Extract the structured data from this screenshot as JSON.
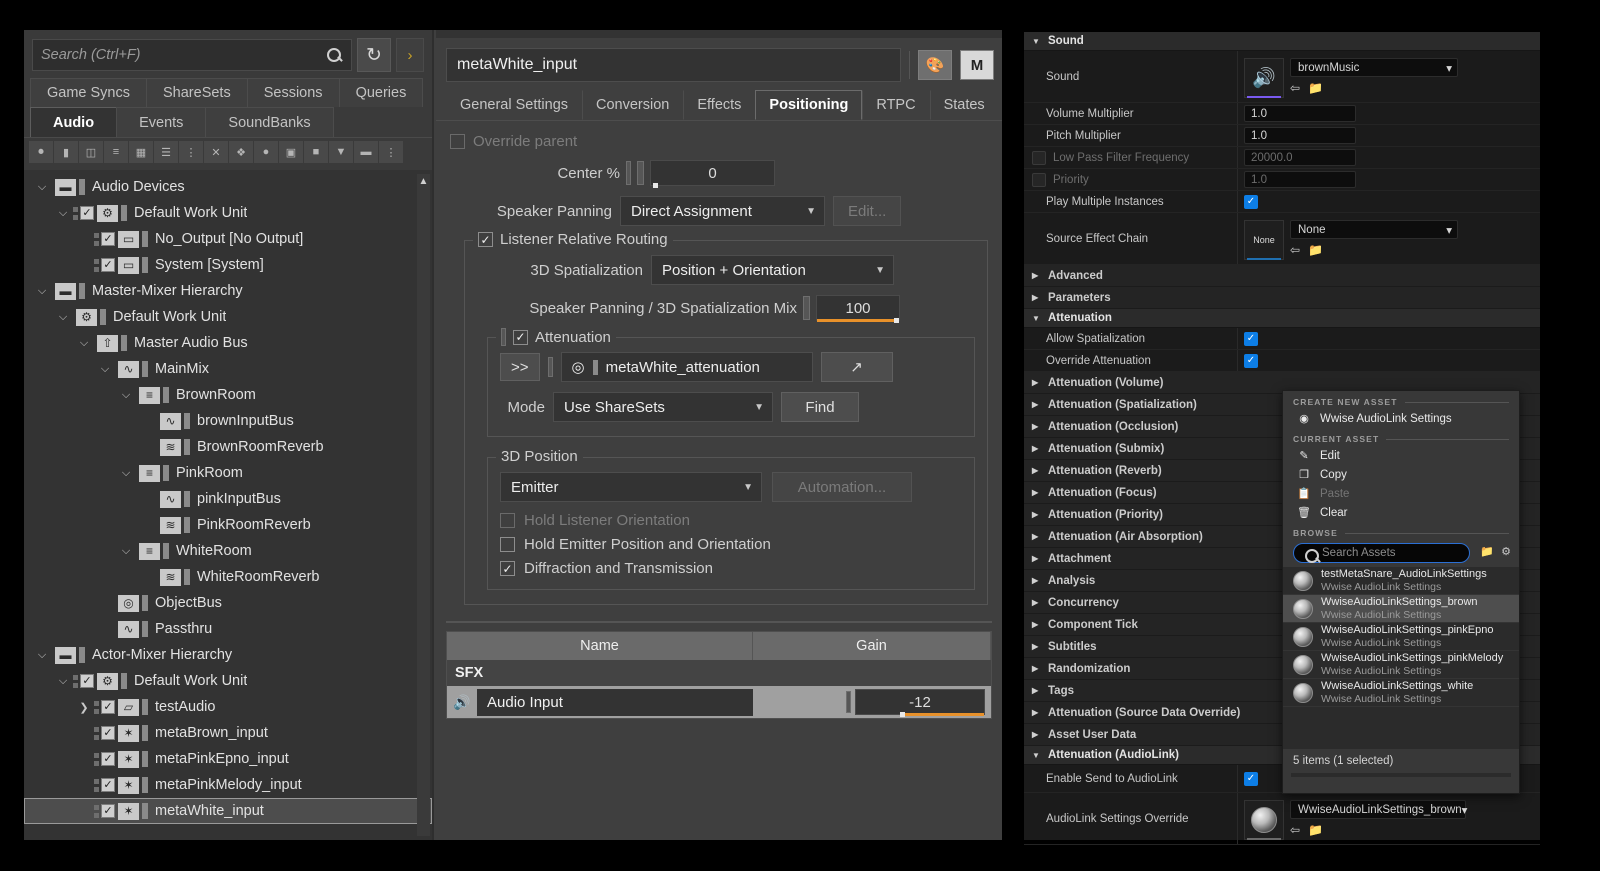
{
  "wwise": {
    "search": {
      "placeholder": "Search (Ctrl+F)",
      "value": ""
    },
    "refresh_label": "↻",
    "next_label": "›",
    "tabs_row1": [
      "Game Syncs",
      "ShareSets",
      "Sessions",
      "Queries"
    ],
    "tabs_row2": [
      "Audio",
      "Events",
      "SoundBanks"
    ],
    "active_tab_row2": "Audio",
    "tree": [
      {
        "label": "Audio Devices",
        "indent": 0,
        "twisty": "down",
        "check": false,
        "icon": "folder-icon"
      },
      {
        "label": "Default Work Unit",
        "indent": 1,
        "twisty": "down",
        "check": true,
        "icon": "work-unit-icon"
      },
      {
        "label": "No_Output [No Output]",
        "indent": 2,
        "twisty": "none",
        "check": true,
        "icon": "audio-device-icon"
      },
      {
        "label": "System [System]",
        "indent": 2,
        "twisty": "none",
        "check": true,
        "icon": "audio-device-icon"
      },
      {
        "label": "Master-Mixer Hierarchy",
        "indent": 0,
        "twisty": "down",
        "check": false,
        "icon": "folder-icon"
      },
      {
        "label": "Default Work Unit",
        "indent": 1,
        "twisty": "down",
        "check": false,
        "icon": "work-unit-icon"
      },
      {
        "label": "Master Audio Bus",
        "indent": 2,
        "twisty": "down",
        "check": false,
        "icon": "master-bus-icon"
      },
      {
        "label": "MainMix",
        "indent": 3,
        "twisty": "down",
        "check": false,
        "icon": "bus-icon"
      },
      {
        "label": "BrownRoom",
        "indent": 4,
        "twisty": "down",
        "check": false,
        "icon": "aux-bus-icon"
      },
      {
        "label": "brownInputBus",
        "indent": 5,
        "twisty": "none",
        "check": false,
        "icon": "bus-icon"
      },
      {
        "label": "BrownRoomReverb",
        "indent": 5,
        "twisty": "none",
        "check": false,
        "icon": "aux-reverb-icon"
      },
      {
        "label": "PinkRoom",
        "indent": 4,
        "twisty": "down",
        "check": false,
        "icon": "aux-bus-icon"
      },
      {
        "label": "pinkInputBus",
        "indent": 5,
        "twisty": "none",
        "check": false,
        "icon": "bus-icon"
      },
      {
        "label": "PinkRoomReverb",
        "indent": 5,
        "twisty": "none",
        "check": false,
        "icon": "aux-reverb-icon"
      },
      {
        "label": "WhiteRoom",
        "indent": 4,
        "twisty": "down",
        "check": false,
        "icon": "aux-bus-icon"
      },
      {
        "label": "WhiteRoomReverb",
        "indent": 5,
        "twisty": "none",
        "check": false,
        "icon": "aux-reverb-icon"
      },
      {
        "label": "ObjectBus",
        "indent": 3,
        "twisty": "none",
        "check": false,
        "icon": "object-bus-icon"
      },
      {
        "label": "Passthru",
        "indent": 3,
        "twisty": "none",
        "check": false,
        "icon": "bus-icon"
      },
      {
        "label": "Actor-Mixer Hierarchy",
        "indent": 0,
        "twisty": "down",
        "check": false,
        "icon": "folder-icon"
      },
      {
        "label": "Default Work Unit",
        "indent": 1,
        "twisty": "down",
        "check": true,
        "icon": "work-unit-icon"
      },
      {
        "label": "testAudio",
        "indent": 2,
        "twisty": "right",
        "check": true,
        "icon": "folder-open-icon"
      },
      {
        "label": "metaBrown_input",
        "indent": 2,
        "twisty": "none",
        "check": true,
        "icon": "sound-sfx-icon"
      },
      {
        "label": "metaPinkEpno_input",
        "indent": 2,
        "twisty": "none",
        "check": true,
        "icon": "sound-sfx-icon"
      },
      {
        "label": "metaPinkMelody_input",
        "indent": 2,
        "twisty": "none",
        "check": true,
        "icon": "sound-sfx-icon"
      },
      {
        "label": "metaWhite_input",
        "indent": 2,
        "twisty": "none",
        "check": true,
        "icon": "sound-sfx-icon",
        "selected": true
      }
    ]
  },
  "editor": {
    "object_name": "metaWhite_input",
    "palette_icon_label": "🎨",
    "mixer_btn_label": "M",
    "tabs": [
      "General Settings",
      "Conversion",
      "Effects",
      "Positioning",
      "RTPC",
      "States"
    ],
    "active_tab": "Positioning",
    "override_parent": {
      "label": "Override parent",
      "checked": false,
      "enabled": false
    },
    "center_percent": {
      "label": "Center %",
      "value": "0"
    },
    "speaker_panning": {
      "label": "Speaker Panning",
      "value": "Direct Assignment",
      "edit_label": "Edit..."
    },
    "listener_relative_routing": {
      "label": "Listener Relative Routing",
      "checked": true
    },
    "spatialization_3d": {
      "label": "3D Spatialization",
      "value": "Position + Orientation"
    },
    "panning_mix": {
      "label": "Speaker Panning / 3D Spatialization Mix",
      "value": "100"
    },
    "attenuation": {
      "label": "Attenuation",
      "checked": true,
      "shareset_button": ">>",
      "shareset_name": "metaWhite_attenuation",
      "open_button": "↗",
      "mode_label": "Mode",
      "mode_value": "Use ShareSets",
      "find_label": "Find"
    },
    "position_3d": {
      "title": "3D Position",
      "value": "Emitter",
      "automation_label": "Automation...",
      "hold_listener": {
        "label": "Hold Listener Orientation",
        "checked": false,
        "enabled": false
      },
      "hold_emitter": {
        "label": "Hold Emitter Position and Orientation",
        "checked": false
      },
      "diffraction": {
        "label": "Diffraction and Transmission",
        "checked": true
      }
    },
    "contents": {
      "columns": [
        "Name",
        "Gain"
      ],
      "group_label": "SFX",
      "rows": [
        {
          "name": "Audio Input",
          "gain": "-12"
        }
      ]
    }
  },
  "unreal": {
    "sound_category": "Sound",
    "rows": [
      {
        "key": "Sound",
        "type": "asset",
        "value": "brownMusic",
        "thumb": "sound-wave-icon",
        "accent": "#7a5af0"
      },
      {
        "key": "Volume Multiplier",
        "type": "text",
        "value": "1.0",
        "dim": false
      },
      {
        "key": "Pitch Multiplier",
        "type": "text",
        "value": "1.0",
        "dim": false
      },
      {
        "key": "Low Pass Filter Frequency",
        "type": "text-checkbox",
        "value": "20000.0",
        "dim": true
      },
      {
        "key": "Priority",
        "type": "text-checkbox",
        "value": "1.0",
        "dim": true
      },
      {
        "key": "Play Multiple Instances",
        "type": "checkbox",
        "checked": true
      },
      {
        "key": "Source Effect Chain",
        "type": "asset",
        "value": "None",
        "thumb": "None",
        "accent": "#1f6fb0"
      }
    ],
    "categories": [
      "Advanced",
      "Parameters"
    ],
    "attenuation_category": "Attenuation",
    "attenuation_rows": [
      {
        "key": "Allow Spatialization",
        "checked": true
      },
      {
        "key": "Override Attenuation",
        "checked": true
      }
    ],
    "sub_categories": [
      "Attenuation (Volume)",
      "Attenuation (Spatialization)",
      "Attenuation (Occlusion)",
      "Attenuation (Submix)",
      "Attenuation (Reverb)",
      "Attenuation (Focus)",
      "Attenuation (Priority)",
      "Attenuation (Air Absorption)",
      "Attachment",
      "Analysis",
      "Concurrency",
      "Component Tick",
      "Subtitles",
      "Randomization",
      "Tags",
      "Attenuation (Source Data Override)",
      "Asset User Data"
    ],
    "audiolink_category": "Attenuation (AudioLink)",
    "audiolink_rows": [
      {
        "key": "Enable Send to AudioLink",
        "type": "checkbox",
        "checked": true
      },
      {
        "key": "AudioLink Settings Override",
        "type": "asset",
        "value": "WwiseAudioLinkSettings_brown",
        "thumb": "sphere-icon"
      }
    ]
  },
  "picker": {
    "create_new_asset_label": "CREATE NEW ASSET",
    "create_new_asset_item": "Wwise AudioLink Settings",
    "current_asset_label": "CURRENT ASSET",
    "current_asset_items": [
      {
        "label": "Edit",
        "icon": "pencil-icon",
        "disabled": false
      },
      {
        "label": "Copy",
        "icon": "copy-icon",
        "disabled": false
      },
      {
        "label": "Paste",
        "icon": "paste-icon",
        "disabled": true
      },
      {
        "label": "Clear",
        "icon": "trash-icon",
        "disabled": false
      }
    ],
    "browse_label": "BROWSE",
    "search_placeholder": "Search Assets",
    "search_value": "",
    "assets": [
      {
        "name": "testMetaSnare_AudioLinkSettings",
        "type": "Wwise AudioLink Settings",
        "selected": false
      },
      {
        "name": "WwiseAudioLinkSettings_brown",
        "type": "Wwise AudioLink Settings",
        "selected": true
      },
      {
        "name": "WwiseAudioLinkSettings_pinkEpno",
        "type": "Wwise AudioLink Settings",
        "selected": false
      },
      {
        "name": "WwiseAudioLinkSettings_pinkMelody",
        "type": "Wwise AudioLink Settings",
        "selected": false
      },
      {
        "name": "WwiseAudioLinkSettings_white",
        "type": "Wwise AudioLink Settings",
        "selected": false
      }
    ],
    "status": "5 items (1 selected)"
  }
}
